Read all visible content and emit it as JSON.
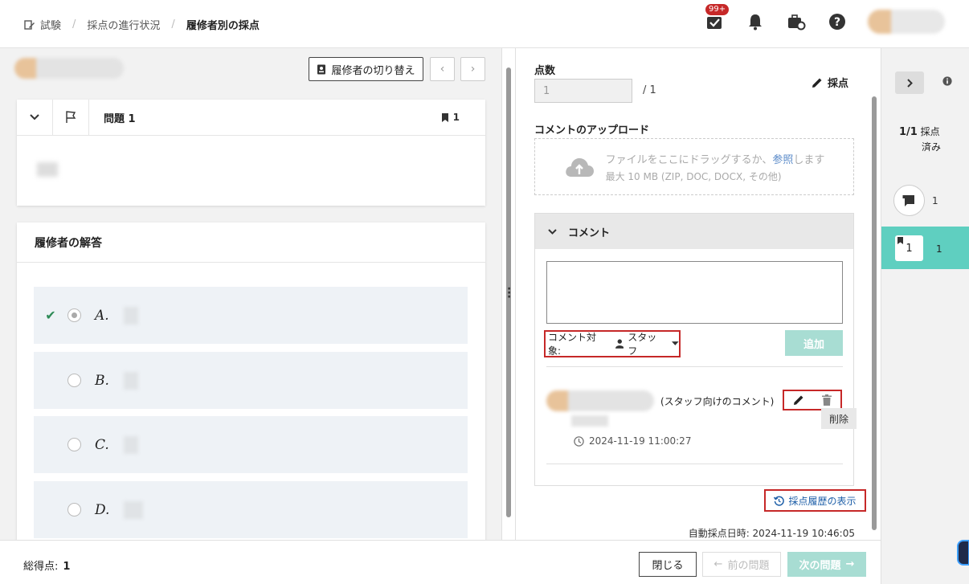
{
  "header": {
    "breadcrumbs": [
      "試験",
      "採点の進行状況",
      "履修者別の採点"
    ],
    "notification_badge": "99+"
  },
  "left": {
    "switch_button": "履修者の切り替え",
    "question": {
      "title": "問題 1",
      "mark_count": "1"
    },
    "answer_card": {
      "title": "履修者の解答",
      "options": [
        {
          "label": "A.",
          "selected": true,
          "correct": true
        },
        {
          "label": "B.",
          "selected": false,
          "correct": false
        },
        {
          "label": "C.",
          "selected": false,
          "correct": false
        },
        {
          "label": "D.",
          "selected": false,
          "correct": false
        }
      ]
    }
  },
  "middle": {
    "score_label": "点数",
    "score_placeholder": "1",
    "score_max": "/ 1",
    "grade_button": "採点",
    "upload_label": "コメントのアップロード",
    "dropzone": {
      "text_before": "ファイルをここにドラッグするか、",
      "text_link": "参照",
      "text_after": "します",
      "hint": "最大 10 MB (ZIP, DOC, DOCX, その他)"
    },
    "comment_panel": {
      "title": "コメント",
      "target_label": "コメント対象:",
      "target_value": "スタッフ",
      "add_button": "追加",
      "comment": {
        "note": "(スタッフ向けのコメント)",
        "timestamp": "2024-11-19 11:00:27",
        "delete_tooltip": "削除"
      }
    },
    "history_link": "採点履歴の表示",
    "auto_grade_time": "自動採点日時: 2024-11-19 10:46:05"
  },
  "right": {
    "graded_count": "1/1",
    "graded_label": "採点",
    "graded_suffix": "済み",
    "comment_count": "1",
    "tile_number": "1",
    "tile_count": "1"
  },
  "footer": {
    "total_label": "総得点:",
    "total_value": "1",
    "close_button": "閉じる",
    "prev_button": "前の問題",
    "next_button": "次の問題"
  },
  "colors": {
    "accent_teal": "#5fcfc0",
    "disabled_teal": "#a8ddd3",
    "highlight_red": "#c62828",
    "link_blue": "#1e5fa8"
  }
}
